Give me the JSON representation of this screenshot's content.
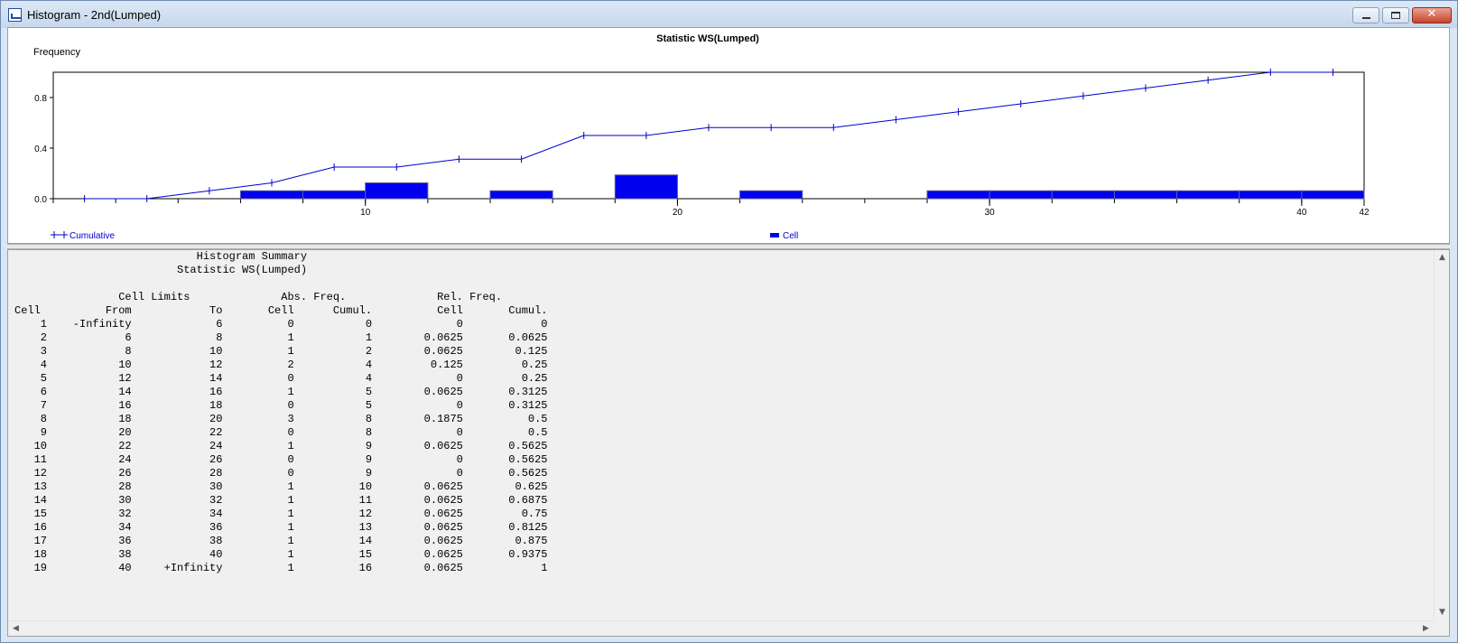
{
  "window": {
    "title": "Histogram - 2nd(Lumped)",
    "close_glyph": "✕"
  },
  "chart_data": {
    "type": "bar",
    "title": "Statistic WS(Lumped)",
    "ylabel": "Frequency",
    "xlabel": "",
    "xlim": [
      0,
      42
    ],
    "ylim": [
      0,
      1
    ],
    "x_ticks": [
      10,
      20,
      30,
      40,
      42
    ],
    "y_ticks": [
      0.0,
      0.4,
      0.8
    ],
    "y_tick_labels": [
      "0.0",
      "0.4",
      "0.8"
    ],
    "grid": false,
    "legend_placement": "bottom",
    "series": [
      {
        "name": "Cumulative",
        "kind": "line",
        "color": "#0000cc",
        "x": [
          1,
          3,
          5,
          7,
          9,
          11,
          13,
          15,
          17,
          19,
          21,
          23,
          25,
          27,
          29,
          31,
          33,
          35,
          37,
          39,
          41
        ],
        "values": [
          0,
          0,
          0.0625,
          0.125,
          0.25,
          0.25,
          0.3125,
          0.3125,
          0.5,
          0.5,
          0.5625,
          0.5625,
          0.5625,
          0.625,
          0.6875,
          0.75,
          0.8125,
          0.875,
          0.9375,
          1,
          1
        ]
      },
      {
        "name": "Cell",
        "kind": "bar",
        "color": "#0000ee",
        "bins": [
          {
            "from": 6,
            "to": 8,
            "value": 0.0625
          },
          {
            "from": 8,
            "to": 10,
            "value": 0.0625
          },
          {
            "from": 10,
            "to": 12,
            "value": 0.125
          },
          {
            "from": 14,
            "to": 16,
            "value": 0.0625
          },
          {
            "from": 18,
            "to": 20,
            "value": 0.1875
          },
          {
            "from": 22,
            "to": 24,
            "value": 0.0625
          },
          {
            "from": 28,
            "to": 30,
            "value": 0.0625
          },
          {
            "from": 30,
            "to": 32,
            "value": 0.0625
          },
          {
            "from": 32,
            "to": 34,
            "value": 0.0625
          },
          {
            "from": 34,
            "to": 36,
            "value": 0.0625
          },
          {
            "from": 36,
            "to": 38,
            "value": 0.0625
          },
          {
            "from": 38,
            "to": 40,
            "value": 0.0625
          },
          {
            "from": 40,
            "to": 42,
            "value": 0.0625
          }
        ]
      }
    ]
  },
  "summary": {
    "title": "Histogram Summary",
    "subtitle": "Statistic WS(Lumped)",
    "group_headers": [
      "Cell Limits",
      "Abs. Freq.",
      "Rel. Freq."
    ],
    "columns": [
      "Cell",
      "From",
      "To",
      "Cell",
      "Cumul.",
      "Cell",
      "Cumul."
    ],
    "rows": [
      [
        "1",
        "-Infinity",
        "6",
        "0",
        "0",
        "0",
        "0"
      ],
      [
        "2",
        "6",
        "8",
        "1",
        "1",
        "0.0625",
        "0.0625"
      ],
      [
        "3",
        "8",
        "10",
        "1",
        "2",
        "0.0625",
        "0.125"
      ],
      [
        "4",
        "10",
        "12",
        "2",
        "4",
        "0.125",
        "0.25"
      ],
      [
        "5",
        "12",
        "14",
        "0",
        "4",
        "0",
        "0.25"
      ],
      [
        "6",
        "14",
        "16",
        "1",
        "5",
        "0.0625",
        "0.3125"
      ],
      [
        "7",
        "16",
        "18",
        "0",
        "5",
        "0",
        "0.3125"
      ],
      [
        "8",
        "18",
        "20",
        "3",
        "8",
        "0.1875",
        "0.5"
      ],
      [
        "9",
        "20",
        "22",
        "0",
        "8",
        "0",
        "0.5"
      ],
      [
        "10",
        "22",
        "24",
        "1",
        "9",
        "0.0625",
        "0.5625"
      ],
      [
        "11",
        "24",
        "26",
        "0",
        "9",
        "0",
        "0.5625"
      ],
      [
        "12",
        "26",
        "28",
        "0",
        "9",
        "0",
        "0.5625"
      ],
      [
        "13",
        "28",
        "30",
        "1",
        "10",
        "0.0625",
        "0.625"
      ],
      [
        "14",
        "30",
        "32",
        "1",
        "11",
        "0.0625",
        "0.6875"
      ],
      [
        "15",
        "32",
        "34",
        "1",
        "12",
        "0.0625",
        "0.75"
      ],
      [
        "16",
        "34",
        "36",
        "1",
        "13",
        "0.0625",
        "0.8125"
      ],
      [
        "17",
        "36",
        "38",
        "1",
        "14",
        "0.0625",
        "0.875"
      ],
      [
        "18",
        "38",
        "40",
        "1",
        "15",
        "0.0625",
        "0.9375"
      ],
      [
        "19",
        "40",
        "+Infinity",
        "1",
        "16",
        "0.0625",
        "1"
      ]
    ]
  },
  "scrollbars": {
    "up_arrow": "▲",
    "down_arrow": "▼",
    "left_arrow": "◀",
    "right_arrow": "▶"
  }
}
